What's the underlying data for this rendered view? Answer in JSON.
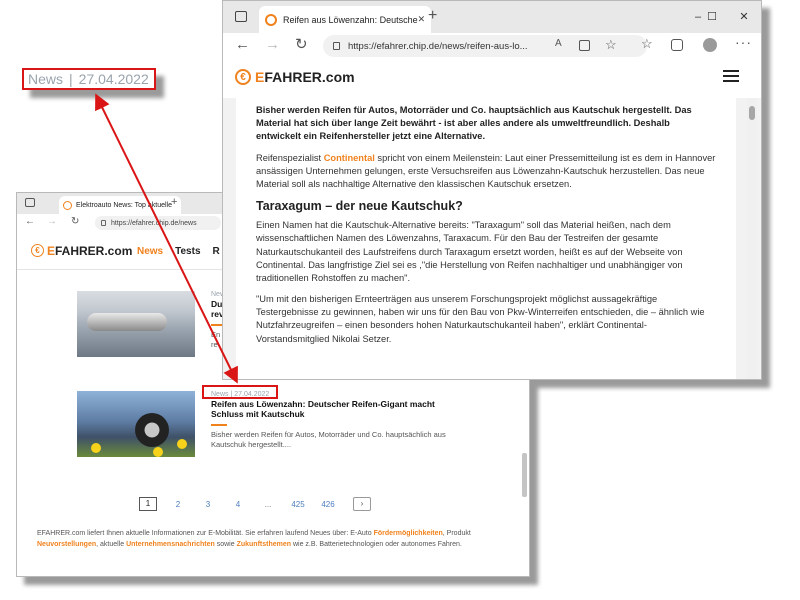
{
  "callout": {
    "category": "News",
    "separator": "|",
    "date": "27.04.2022"
  },
  "back_window": {
    "tab_title": "Elektroauto News: Top aktuelle",
    "url": "https://efahrer.chip.de/news",
    "brand": {
      "prefix": "E",
      "rest": "FAHRER.com"
    },
    "nav": {
      "news": "News",
      "tests": "Tests",
      "third": "R"
    },
    "article1": {
      "meta": "News",
      "title_line1": "Du",
      "title_line2": "rev",
      "teaser_line1": "En",
      "teaser_line2": "re"
    },
    "article2": {
      "meta_category": "News",
      "meta_separator": "|",
      "meta_date": "27.04.2022",
      "title": "Reifen aus Löwenzahn: Deutscher Reifen-Gigant macht Schluss mit Kautschuk",
      "teaser": "Bisher werden Reifen für Autos, Motorräder und Co. hauptsächlich aus Kautschuk hergestellt...."
    },
    "pagination": {
      "current": "1",
      "p2": "2",
      "p3": "3",
      "p4": "4",
      "ellipsis": "...",
      "p425": "425",
      "p426": "426",
      "next": "›"
    },
    "footer": {
      "t1": "EFAHRER.com liefert Ihnen aktuelle Informationen zur E-Mobilität. Sie erfahren laufend Neues über: E-Auto ",
      "l1": "Fördermöglichkeiten",
      "t2": ", Produkt ",
      "l2": "Neuvorstellungen",
      "t3": ", aktuelle ",
      "l3": "Unternehmensnachrichten",
      "t4": " sowie ",
      "l4": "Zukunftsthemen",
      "t5": " wie z.B. Batterietechnologien oder autonomes Fahren."
    }
  },
  "front_window": {
    "tab_title": "Reifen aus Löwenzahn: Deutsche",
    "url": "https://efahrer.chip.de/news/reifen-aus-lo...",
    "brand": {
      "prefix": "E",
      "rest": "FAHRER.com"
    },
    "controls": {
      "minimize": "–",
      "maximize": "☐",
      "close": "✕",
      "tab_close": "✕",
      "new_tab": "+"
    },
    "article": {
      "lead": "Bisher werden Reifen für Autos, Motorräder und Co. hauptsächlich aus Kautschuk hergestellt. Das Material hat sich über lange Zeit bewährt - ist aber alles andere als umweltfreundlich. Deshalb entwickelt ein Reifenhersteller jetzt eine Alternative.",
      "p1_pre": "Reifenspezialist ",
      "p1_link": "Continental",
      "p1_post": " spricht von einem Meilenstein: Laut einer Pressemitteilung ist es dem in Hannover ansässigen Unternehmen gelungen, erste Versuchsreifen aus Löwenzahn-Kautschuk herzustellen. Das neue Material soll als nachhaltige Alternative den klassischen Kautschuk ersetzen.",
      "heading": "Taraxagum – der neue Kautschuk?",
      "p2": "Einen Namen hat die Kautschuk-Alternative bereits: \"Taraxagum\" soll das Material heißen, nach dem wissenschaftlichen Namen des Löwenzahns, Taraxacum. Für den Bau der Testreifen der gesamte Naturkautschukanteil des Laufstreifens durch Taraxagum ersetzt worden, heißt es auf der Webseite von Continental. Das langfristige Ziel sei es ,\"die Herstellung von Reifen nachhaltiger und unabhängiger von traditionellen Rohstoffen zu machen\".",
      "p3": "\"Um mit den bisherigen Ernteerträgen aus unserem Forschungsprojekt möglichst aussagekräftige Testergebnisse zu gewinnen, haben wir uns für den Bau von Pkw-Winterreifen entschieden, die – ähnlich wie Nutzfahrzeugreifen – einen besonders hohen Naturkautschukanteil haben\", erklärt Continental-Vorstandsmitglied Nikolai Setzer."
    }
  },
  "colors": {
    "accent": "#f0821e",
    "annotation_red": "#d91515",
    "meta_gray": "#9aa4ad",
    "link_blue": "#4b7dbf"
  }
}
